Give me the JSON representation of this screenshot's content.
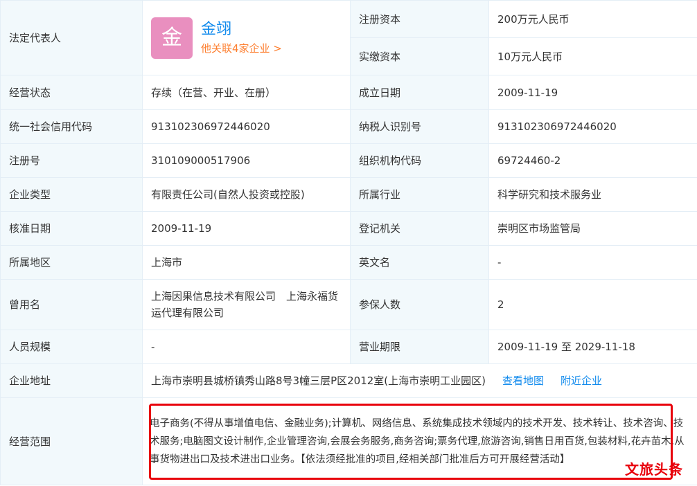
{
  "rows": [
    {
      "l1": "注册资本",
      "v1": "200万元人民币"
    },
    {
      "l1": "实缴资本",
      "v1": "10万元人民币"
    }
  ],
  "legal_rep": {
    "label": "法定代表人",
    "avatar_char": "金",
    "name": "金翊",
    "related": "他关联4家企业 >",
    "avatar_color": "#e98fbf"
  },
  "fields": {
    "status_label": "经营状态",
    "status": "存续（在营、开业、在册）",
    "founded_label": "成立日期",
    "founded": "2009-11-19",
    "credit_label": "统一社会信用代码",
    "credit": "913102306972446020",
    "taxid_label": "纳税人识别号",
    "taxid": "913102306972446020",
    "regno_label": "注册号",
    "regno": "310109000517906",
    "orgcode_label": "组织机构代码",
    "orgcode": "69724460-2",
    "type_label": "企业类型",
    "type": "有限责任公司(自然人投资或控股)",
    "industry_label": "所属行业",
    "industry": "科学研究和技术服务业",
    "approval_label": "核准日期",
    "approval": "2009-11-19",
    "authority_label": "登记机关",
    "authority": "崇明区市场监管局",
    "region_label": "所属地区",
    "region": "上海市",
    "english_label": "英文名",
    "english": "-",
    "former_label": "曾用名",
    "former": "上海因果信息技术有限公司　上海永福货运代理有限公司",
    "insured_label": "参保人数",
    "insured": "2",
    "staff_label": "人员规模",
    "staff": "-",
    "term_label": "营业期限",
    "term": "2009-11-19 至 2029-11-18",
    "address_label": "企业地址",
    "address": "上海市崇明县城桥镇秀山路8号3幢三层P区2012室(上海市崇明工业园区)",
    "map_link": "查看地图",
    "nearby_link": "附近企业",
    "scope_label": "经营范围",
    "scope": "电子商务(不得从事增值电信、金融业务);计算机、网络信息、系统集成技术领域内的技术开发、技术转让、技术咨询、技术服务;电脑图文设计制作,企业管理咨询,会展会务服务,商务咨询;票务代理,旅游咨询,销售日用百货,包装材料,花卉苗木,从事货物进出口及技术进出口业务。【依法须经批准的项目,经相关部门批准后方可开展经营活动】"
  },
  "watermark": "文旅头条",
  "colors": {
    "label_bg": "#f2f9fc",
    "border": "#e4eef6",
    "link": "#128bed",
    "orange": "#fd7f30",
    "red": "#e8000b"
  }
}
